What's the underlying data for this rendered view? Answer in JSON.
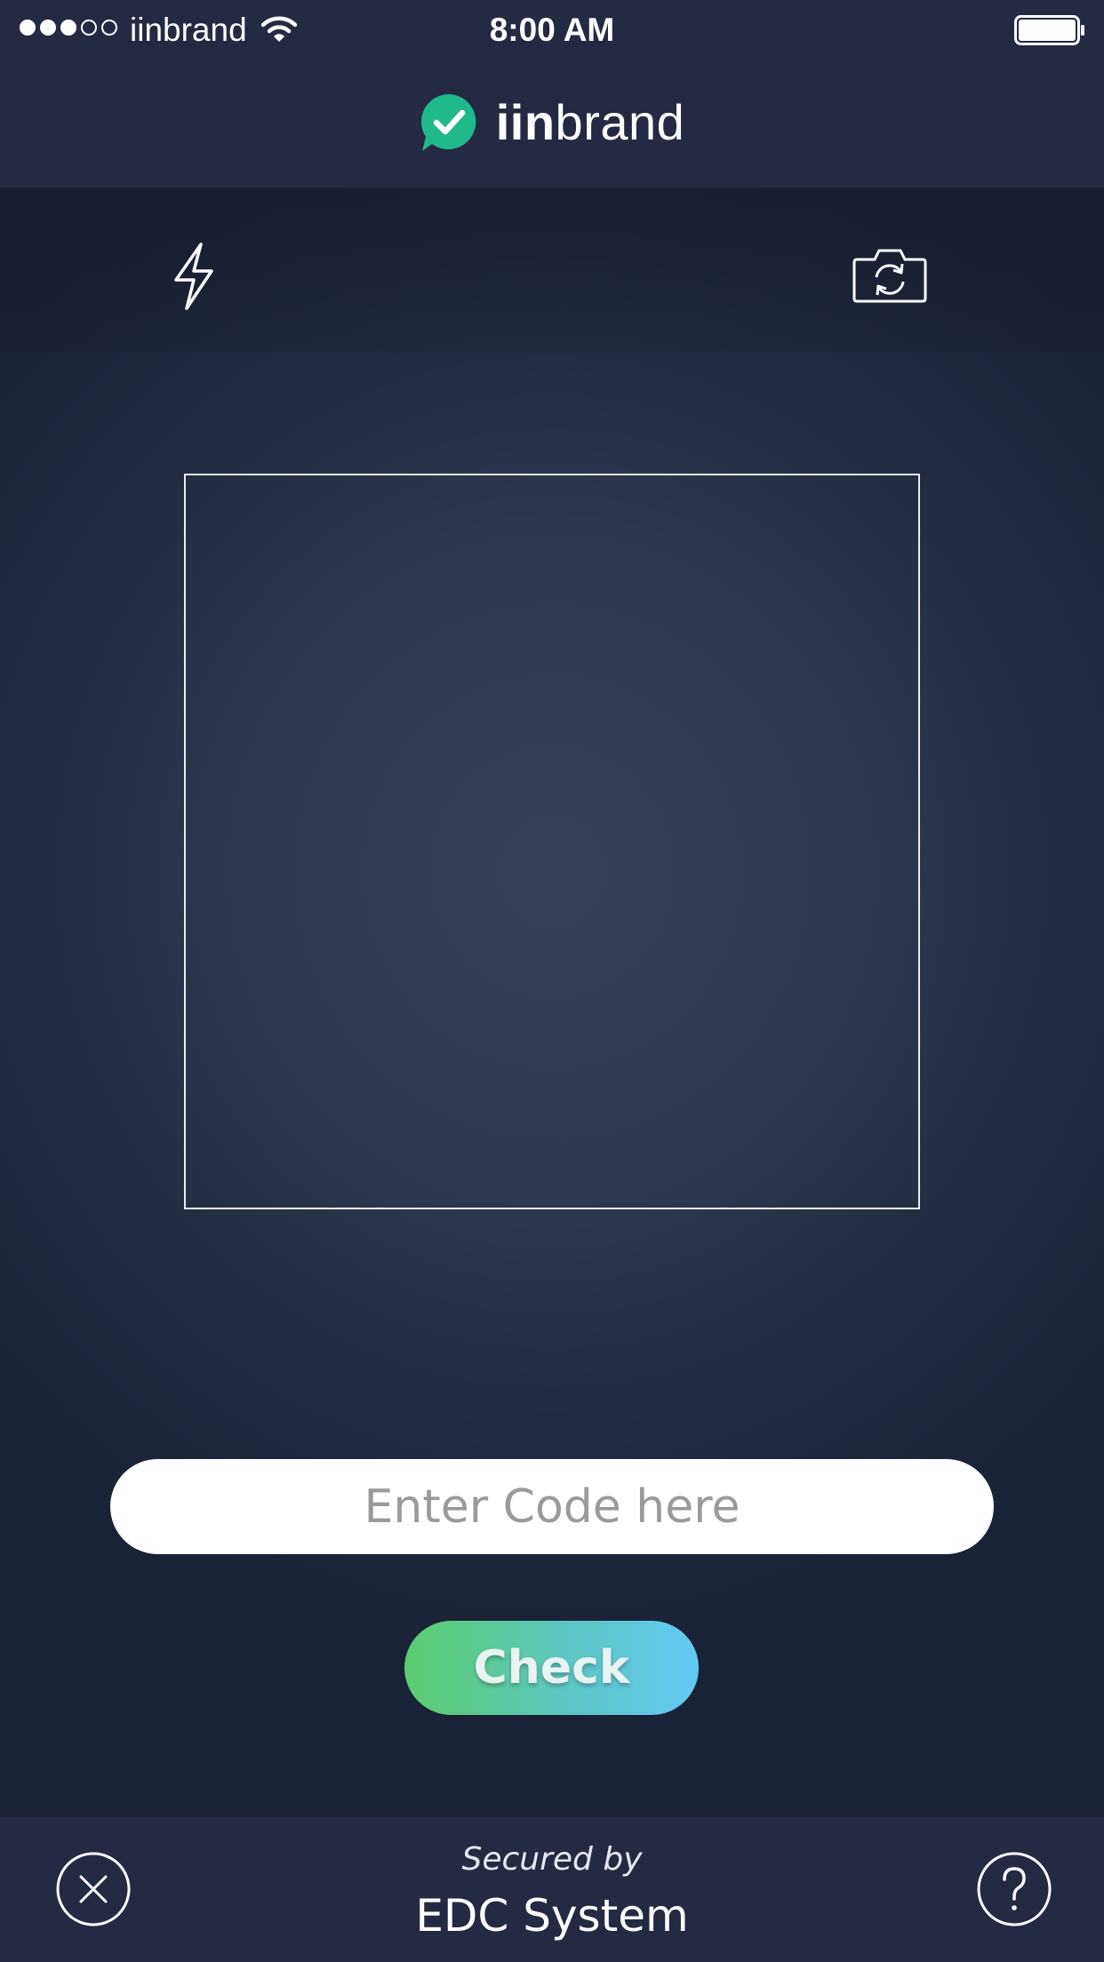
{
  "status_bar": {
    "carrier": "iinbrand",
    "time": "8:00 AM",
    "signal_bars_filled": 3,
    "signal_bars_total": 5,
    "battery_level": 1.0
  },
  "header": {
    "brand_bold": "iin",
    "brand_light": "brand",
    "logo_icon": "checkmark-speech-bubble-icon",
    "logo_color": "#1fb98a"
  },
  "camera": {
    "flash_icon": "lightning-bolt-icon",
    "switch_camera_icon": "camera-switch-icon"
  },
  "code_input": {
    "placeholder": "Enter Code here",
    "value": ""
  },
  "check_button": {
    "label": "Check",
    "gradient": [
      "#5bcd6e",
      "#62c8f4"
    ]
  },
  "footer": {
    "secured_by": "Secured by",
    "system_name": "EDC System",
    "close_icon": "close-circle-icon",
    "help_icon": "question-circle-icon"
  }
}
